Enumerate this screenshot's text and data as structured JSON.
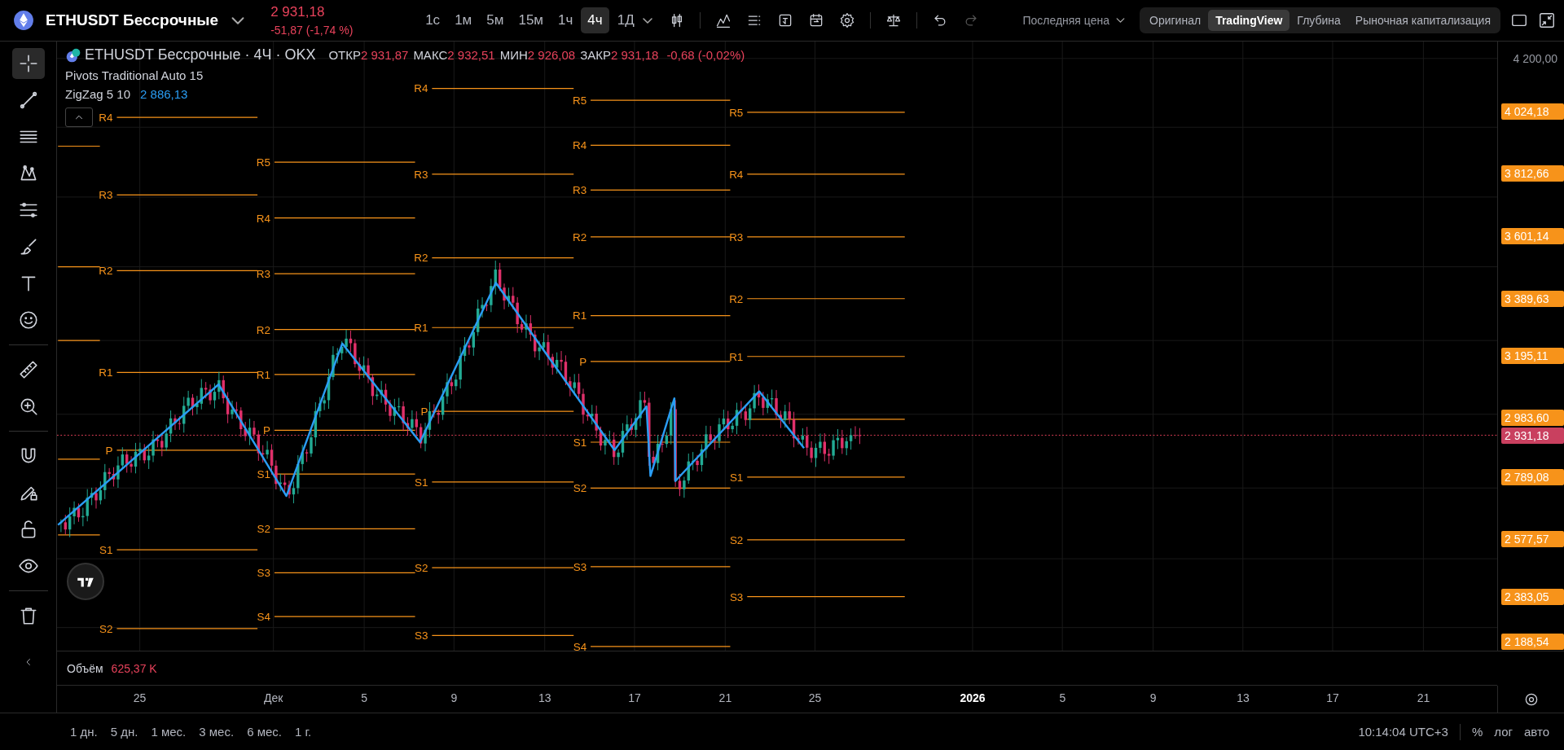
{
  "header": {
    "symbol": "ETHUSDT Бессрочные",
    "price": "2 931,18",
    "change": "-51,87 (-1,74 %)",
    "intervals": [
      {
        "label": "1с",
        "selected": false
      },
      {
        "label": "1м",
        "selected": false
      },
      {
        "label": "5м",
        "selected": false
      },
      {
        "label": "15м",
        "selected": false
      },
      {
        "label": "1ч",
        "selected": false
      },
      {
        "label": "4ч",
        "selected": true
      },
      {
        "label": "1Д",
        "selected": false
      }
    ],
    "price_source": "Последняя цена",
    "views": [
      {
        "label": "Оригинал",
        "selected": false
      },
      {
        "label": "TradingView",
        "selected": true
      },
      {
        "label": "Глубина",
        "selected": false
      },
      {
        "label": "Рыночная капитализация",
        "selected": false
      }
    ]
  },
  "toolbar": {
    "tools": [
      {
        "selected": true
      },
      {
        "selected": false
      },
      {
        "selected": false
      },
      {
        "selected": false
      },
      {
        "selected": false
      },
      {
        "selected": false
      },
      {
        "selected": false
      },
      {
        "selected": false
      },
      {
        "selected": false
      },
      {
        "selected": false
      },
      {
        "selected": false
      },
      {
        "selected": false
      },
      {
        "selected": false
      },
      {
        "selected": false
      },
      {
        "selected": false
      }
    ]
  },
  "legend": {
    "title": "ETHUSDT Бессрочные · 4Ч · OKX",
    "ohlc": [
      {
        "label": "ОТКР",
        "value": "2 931,87"
      },
      {
        "label": "МАКС",
        "value": "2 932,51"
      },
      {
        "label": "МИН",
        "value": "2 926,08"
      },
      {
        "label": "ЗАКР",
        "value": "2 931,18"
      }
    ],
    "change": "-0,68 (-0,02%)",
    "indicators": [
      {
        "name": "Pivots Traditional Auto 15"
      },
      {
        "name": "ZigZag 5 10",
        "value": "2 886,13"
      }
    ]
  },
  "pivots": [
    {
      "labels": [
        "R4",
        "R3",
        "R2",
        "R1",
        "P",
        "S1",
        "S2"
      ]
    },
    {
      "labels": [
        "R5",
        "R4",
        "R3",
        "R2",
        "R1",
        "P",
        "S1",
        "S2",
        "S3",
        "S4"
      ]
    },
    {
      "labels": [
        "R4",
        "R3",
        "R2",
        "R1",
        "P",
        "S1",
        "S2",
        "S3"
      ]
    },
    {
      "labels": [
        "R5",
        "R4",
        "R3",
        "R2",
        "R1",
        "P",
        "S1",
        "S2",
        "S3",
        "S4"
      ]
    },
    {
      "labels": [
        "R5",
        "R4",
        "R3",
        "R2",
        "R1",
        "S1",
        "S2",
        "S3"
      ]
    }
  ],
  "price_axis": {
    "labels": [
      {
        "text": "4 200,00",
        "kind": "plain"
      },
      {
        "text": "4 024,18",
        "kind": "pivot"
      },
      {
        "text": "3 812,66",
        "kind": "pivot"
      },
      {
        "text": "3 601,14",
        "kind": "pivot"
      },
      {
        "text": "3 389,63",
        "kind": "pivot"
      },
      {
        "text": "3 195,11",
        "kind": "pivot"
      },
      {
        "text": "2 983,60",
        "kind": "pivot"
      },
      {
        "text": "2 931,18",
        "kind": "last"
      },
      {
        "text": "2 789,08",
        "kind": "pivot"
      },
      {
        "text": "2 577,57",
        "kind": "pivot"
      },
      {
        "text": "2 383,05",
        "kind": "pivot"
      },
      {
        "text": "2 188,54",
        "kind": "pivot"
      }
    ]
  },
  "volume": {
    "label": "Объём",
    "value": "625,37 K"
  },
  "time_axis": {
    "labels": [
      {
        "text": "25",
        "bold": false
      },
      {
        "text": "Дек",
        "bold": false
      },
      {
        "text": "5",
        "bold": false
      },
      {
        "text": "9",
        "bold": false
      },
      {
        "text": "13",
        "bold": false
      },
      {
        "text": "17",
        "bold": false
      },
      {
        "text": "21",
        "bold": false
      },
      {
        "text": "25",
        "bold": false
      },
      {
        "text": "2026",
        "bold": true
      },
      {
        "text": "5",
        "bold": false
      },
      {
        "text": "9",
        "bold": false
      },
      {
        "text": "13",
        "bold": false
      },
      {
        "text": "17",
        "bold": false
      },
      {
        "text": "21",
        "bold": false
      }
    ]
  },
  "ranges": [
    "1 дн.",
    "5 дн.",
    "1 мес.",
    "3 мес.",
    "6 мес.",
    "1 г."
  ],
  "status": {
    "time": "10:14:04 UTC+3",
    "percent": "%",
    "log": "лог",
    "auto": "авто"
  }
}
